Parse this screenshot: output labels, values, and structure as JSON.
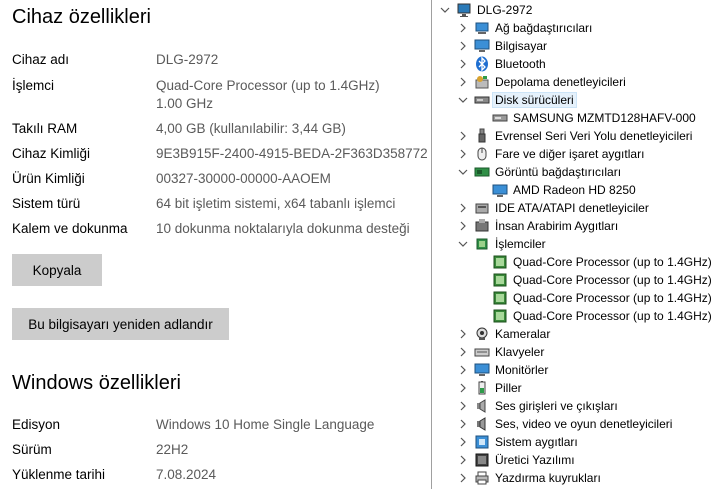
{
  "device_specs": {
    "title": "Cihaz özellikleri",
    "rows": [
      {
        "label": "Cihaz adı",
        "value": "DLG-2972"
      },
      {
        "label": "İşlemci",
        "value": "Quad-Core Processor (up to 1.4GHz)",
        "value2": "1.00 GHz"
      },
      {
        "label": "Takılı RAM",
        "value": "4,00 GB (kullanılabilir: 3,44 GB)"
      },
      {
        "label": "Cihaz Kimliği",
        "value": "9E3B915F-2400-4915-BEDA-2F363D358772"
      },
      {
        "label": "Ürün Kimliği",
        "value": "00327-30000-00000-AAOEM"
      },
      {
        "label": "Sistem türü",
        "value": "64 bit işletim sistemi, x64 tabanlı işlemci"
      },
      {
        "label": "Kalem ve dokunma",
        "value": "10 dokunma noktalarıyla dokunma desteği"
      }
    ],
    "copy_button": "Kopyala",
    "rename_button": "Bu bilgisayarı yeniden adlandır"
  },
  "windows_specs": {
    "title": "Windows özellikleri",
    "rows": [
      {
        "label": "Edisyon",
        "value": "Windows 10 Home Single Language"
      },
      {
        "label": "Sürüm",
        "value": "22H2"
      },
      {
        "label": "Yüklenme tarihi",
        "value": "7.08.2024"
      }
    ]
  },
  "device_manager": {
    "root": "DLG-2972",
    "items": [
      {
        "label": "Ağ bağdaştırıcıları",
        "icon": "network-adapter-icon"
      },
      {
        "label": "Bilgisayar",
        "icon": "computer-icon"
      },
      {
        "label": "Bluetooth",
        "icon": "bluetooth-icon"
      },
      {
        "label": "Depolama denetleyicileri",
        "icon": "storage-controller-icon"
      },
      {
        "label": "Disk sürücüleri",
        "icon": "disk-drive-icon",
        "expanded": true,
        "selected": true,
        "children": [
          "SAMSUNG MZMTD128HAFV-000"
        ]
      },
      {
        "label": "Evrensel Seri Veri Yolu denetleyicileri",
        "icon": "usb-icon"
      },
      {
        "label": "Fare ve diğer işaret aygıtları",
        "icon": "mouse-icon"
      },
      {
        "label": "Görüntü bağdaştırıcıları",
        "icon": "display-adapter-icon",
        "expanded": true,
        "children": [
          "AMD Radeon HD 8250"
        ]
      },
      {
        "label": "IDE ATA/ATAPI denetleyiciler",
        "icon": "ide-controller-icon"
      },
      {
        "label": "İnsan Arabirim Aygıtları",
        "icon": "hid-icon"
      },
      {
        "label": "İşlemciler",
        "icon": "processor-icon",
        "expanded": true,
        "children": [
          "Quad-Core Processor (up to 1.4GHz)",
          "Quad-Core Processor (up to 1.4GHz)",
          "Quad-Core Processor (up to 1.4GHz)",
          "Quad-Core Processor (up to 1.4GHz)"
        ]
      },
      {
        "label": "Kameralar",
        "icon": "camera-icon"
      },
      {
        "label": "Klavyeler",
        "icon": "keyboard-icon"
      },
      {
        "label": "Monitörler",
        "icon": "monitor-icon"
      },
      {
        "label": "Piller",
        "icon": "battery-icon"
      },
      {
        "label": "Ses girişleri ve çıkışları",
        "icon": "audio-io-icon"
      },
      {
        "label": "Ses, video ve oyun denetleyicileri",
        "icon": "sound-controller-icon"
      },
      {
        "label": "Sistem aygıtları",
        "icon": "system-device-icon"
      },
      {
        "label": "Üretici Yazılımı",
        "icon": "firmware-icon"
      },
      {
        "label": "Yazdırma kuyrukları",
        "icon": "print-queue-icon"
      }
    ]
  }
}
